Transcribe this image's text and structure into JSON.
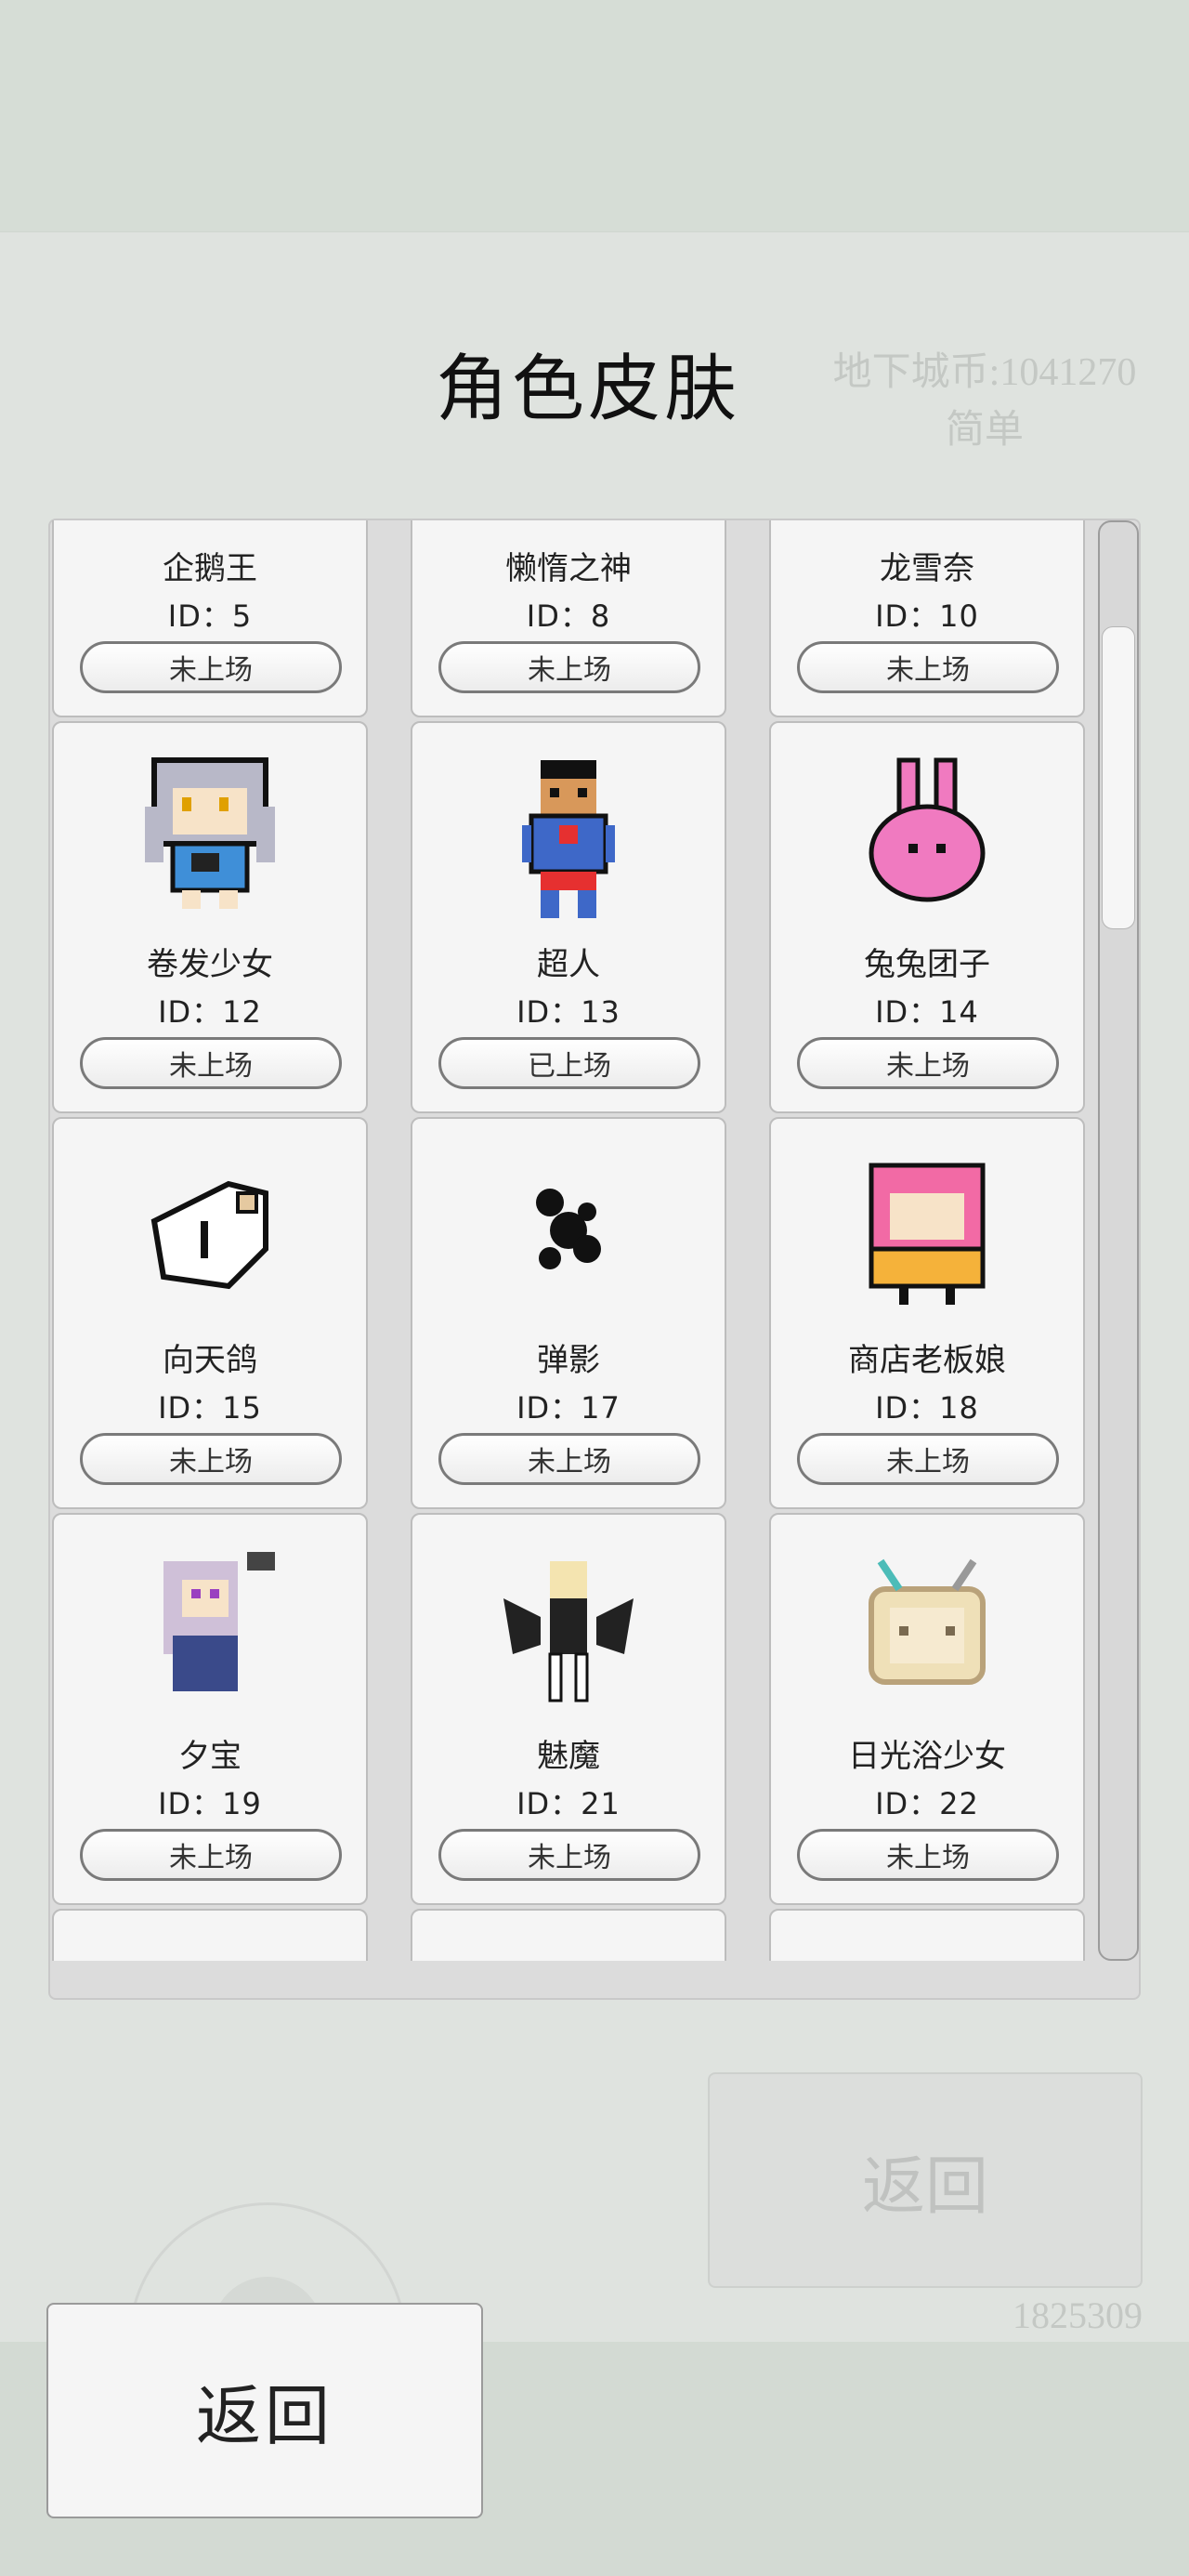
{
  "title": "角色皮肤",
  "background": {
    "currency_line": "地下城币:1041270",
    "difficulty": "简单",
    "back_label": "返回",
    "number": "1825309"
  },
  "cards": [
    {
      "name": "企鹅王",
      "id": "ID：5",
      "status": "未上场",
      "icon": "penguin-king-icon"
    },
    {
      "name": "懒惰之神",
      "id": "ID：8",
      "status": "未上场",
      "icon": "sloth-god-icon"
    },
    {
      "name": "龙雪奈",
      "id": "ID：10",
      "status": "未上场",
      "icon": "long-xuenai-icon"
    },
    {
      "name": "卷发少女",
      "id": "ID：12",
      "status": "未上场",
      "icon": "curly-hair-girl-icon"
    },
    {
      "name": "超人",
      "id": "ID：13",
      "status": "已上场",
      "icon": "superman-icon"
    },
    {
      "name": "兔兔团子",
      "id": "ID：14",
      "status": "未上场",
      "icon": "bunny-dumpling-icon"
    },
    {
      "name": "向天鸽",
      "id": "ID：15",
      "status": "未上场",
      "icon": "pigeon-icon"
    },
    {
      "name": "弹影",
      "id": "ID：17",
      "status": "未上场",
      "icon": "shadow-ball-icon"
    },
    {
      "name": "商店老板娘",
      "id": "ID：18",
      "status": "未上场",
      "icon": "shop-owner-icon"
    },
    {
      "name": "夕宝",
      "id": "ID：19",
      "status": "未上场",
      "icon": "xibao-girl-icon"
    },
    {
      "name": "魅魔",
      "id": "ID：21",
      "status": "未上场",
      "icon": "succubus-icon"
    },
    {
      "name": "日光浴少女",
      "id": "ID：22",
      "status": "未上场",
      "icon": "tv-girl-icon"
    },
    {
      "name": "",
      "id": "",
      "status": "",
      "icon": "pink-char-icon"
    },
    {
      "name": "",
      "id": "",
      "status": "",
      "icon": "cat-char-icon"
    },
    {
      "name": "",
      "id": "",
      "status": "",
      "icon": "purple-char-icon"
    }
  ],
  "back_button": "返回"
}
